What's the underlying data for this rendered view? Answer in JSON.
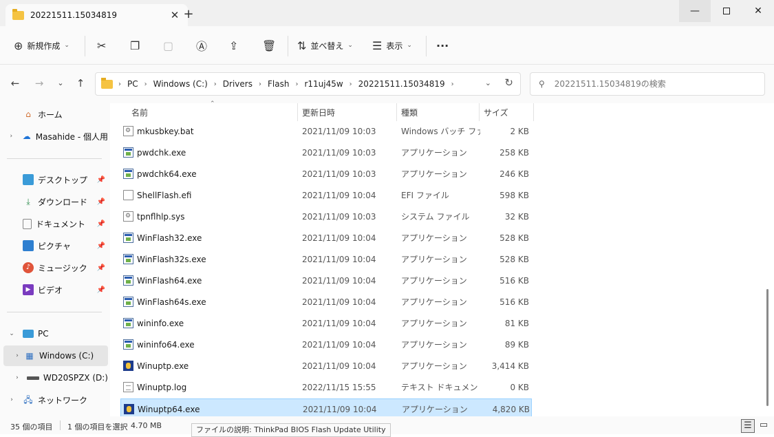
{
  "tab": {
    "title": "20221511.15034819"
  },
  "window": {
    "minimize": "—",
    "close": "✕"
  },
  "toolbar": {
    "new_label": "新規作成",
    "sort_label": "並べ替え",
    "view_label": "表示",
    "more": "···"
  },
  "address": {
    "crumbs": [
      "PC",
      "Windows (C:)",
      "Drivers",
      "Flash",
      "r11uj45w",
      "20221511.15034819"
    ],
    "search_placeholder": "20221511.15034819の検索"
  },
  "nav": {
    "home": "ホーム",
    "onedrive": "Masahide - 個人用",
    "desktop": "デスクトップ",
    "downloads": "ダウンロード",
    "documents": "ドキュメント",
    "pictures": "ピクチャ",
    "music": "ミュージック",
    "videos": "ビデオ",
    "pc": "PC",
    "drive_c": "Windows (C:)",
    "drive_d": "WD20SPZX (D:)",
    "network": "ネットワーク"
  },
  "columns": {
    "name": "名前",
    "date": "更新日時",
    "type": "種類",
    "size": "サイズ"
  },
  "files": [
    {
      "name": "mkusbkey.bat",
      "date": "2021/11/09 10:03",
      "type": "Windows バッチ ファ...",
      "size": "2 KB",
      "icon": "bat"
    },
    {
      "name": "pwdchk.exe",
      "date": "2021/11/09 10:03",
      "type": "アプリケーション",
      "size": "258 KB",
      "icon": "exe"
    },
    {
      "name": "pwdchk64.exe",
      "date": "2021/11/09 10:03",
      "type": "アプリケーション",
      "size": "246 KB",
      "icon": "exe"
    },
    {
      "name": "ShellFlash.efi",
      "date": "2021/11/09 10:04",
      "type": "EFI ファイル",
      "size": "598 KB",
      "icon": "doc"
    },
    {
      "name": "tpnflhlp.sys",
      "date": "2021/11/09 10:03",
      "type": "システム ファイル",
      "size": "32 KB",
      "icon": "sys"
    },
    {
      "name": "WinFlash32.exe",
      "date": "2021/11/09 10:04",
      "type": "アプリケーション",
      "size": "528 KB",
      "icon": "exe"
    },
    {
      "name": "WinFlash32s.exe",
      "date": "2021/11/09 10:04",
      "type": "アプリケーション",
      "size": "528 KB",
      "icon": "exe"
    },
    {
      "name": "WinFlash64.exe",
      "date": "2021/11/09 10:04",
      "type": "アプリケーション",
      "size": "516 KB",
      "icon": "exe"
    },
    {
      "name": "WinFlash64s.exe",
      "date": "2021/11/09 10:04",
      "type": "アプリケーション",
      "size": "516 KB",
      "icon": "exe"
    },
    {
      "name": "wininfo.exe",
      "date": "2021/11/09 10:04",
      "type": "アプリケーション",
      "size": "81 KB",
      "icon": "exe"
    },
    {
      "name": "wininfo64.exe",
      "date": "2021/11/09 10:04",
      "type": "アプリケーション",
      "size": "89 KB",
      "icon": "exe"
    },
    {
      "name": "Winuptp.exe",
      "date": "2021/11/09 10:04",
      "type": "アプリケーション",
      "size": "3,414 KB",
      "icon": "win"
    },
    {
      "name": "Winuptp.log",
      "date": "2022/11/15 15:55",
      "type": "テキスト ドキュメント",
      "size": "0 KB",
      "icon": "log"
    },
    {
      "name": "Winuptp64.exe",
      "date": "2021/11/09 10:04",
      "type": "アプリケーション",
      "size": "4,820 KB",
      "icon": "win",
      "selected": true
    }
  ],
  "status": {
    "count": "35 個の項目",
    "selected": "1 個の項目を選択",
    "size": "4.70 MB",
    "tooltip": "ファイルの説明: ThinkPad BIOS Flash Update Utility"
  }
}
